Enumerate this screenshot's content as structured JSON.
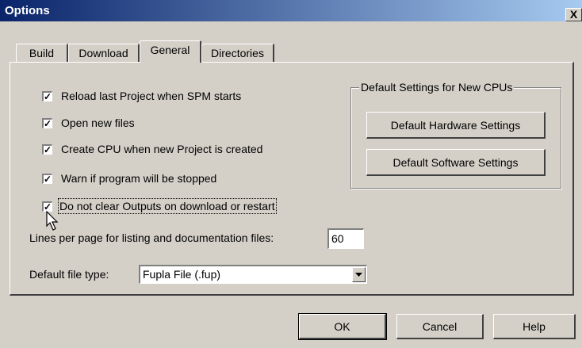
{
  "window": {
    "title": "Options",
    "close_label": "X"
  },
  "tabs": [
    {
      "label": "Build",
      "active": false
    },
    {
      "label": "Download",
      "active": false
    },
    {
      "label": "General",
      "active": true
    },
    {
      "label": "Directories",
      "active": false
    }
  ],
  "options": [
    {
      "label": "Reload last Project when SPM starts",
      "checked": true
    },
    {
      "label": "Open new files",
      "checked": true
    },
    {
      "label": "Create CPU when new Project is created",
      "checked": true
    },
    {
      "label": "Warn if program will be stopped",
      "checked": true
    },
    {
      "label": "Do not clear Outputs on download or restart",
      "checked": true
    }
  ],
  "check_glyph": "✓",
  "lines_per_page": {
    "label": "Lines per page for listing and documentation files:",
    "value": "60"
  },
  "default_file_type": {
    "label": "Default file type:",
    "selected": "Fupla File (.fup)"
  },
  "cpu_defaults": {
    "title": "Default Settings for New CPUs",
    "hardware_button": "Default Hardware Settings",
    "software_button": "Default Software Settings"
  },
  "footer": {
    "ok": "OK",
    "cancel": "Cancel",
    "help": "Help"
  },
  "colors": {
    "face": "#d4d0c8",
    "title_start": "#0a246a",
    "title_end": "#a6caf0"
  }
}
